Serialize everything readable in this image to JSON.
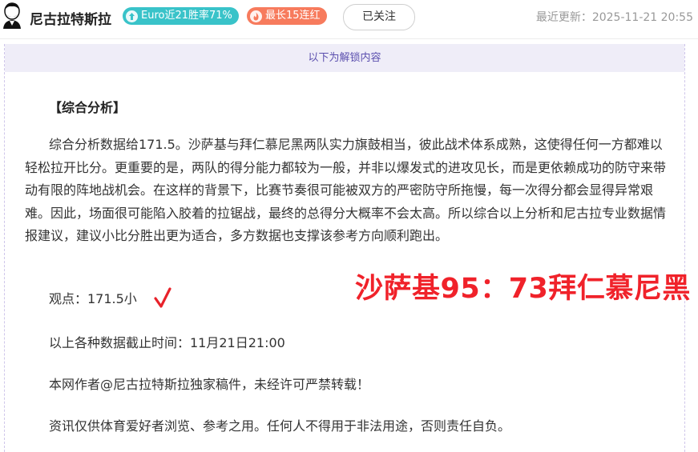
{
  "header": {
    "author_name": "尼古拉特斯拉",
    "badges": [
      {
        "label": "Euro近21胜率71%",
        "icon": "arrow-up-icon",
        "color": "#39c3c9"
      },
      {
        "label": "最长15连红",
        "icon": "flame-icon",
        "color": "#f77b5d"
      }
    ],
    "follow_label": "已关注",
    "updated_label": "最近更新：2025-11-21 20:55"
  },
  "content": {
    "unlock_notice": "以下为解锁内容",
    "section_title": "【综合分析】",
    "paragraph": "综合分析数据给171.5。沙萨基与拜仁慕尼黑两队实力旗鼓相当，彼此战术体系成熟，这使得任何一方都难以轻松拉开比分。更重要的是，两队的得分能力都较为一般，并非以爆发式的进攻见长，而是更依赖成功的防守来带动有限的阵地战机会。在这样的背景下，比赛节奏很可能被双方的严密防守所拖慢，每一次得分都会显得异常艰难。因此，场面很可能陷入胶着的拉锯战，最终的总得分大概率不会太高。所以综合以上分析和尼古拉专业数据情报建议，建议小比分胜出更为适合，多方数据也支撑该参考方向顺利跑出。",
    "viewpoint": "观点：171.5小",
    "deadline": "以上各种数据截止时间：11月21日21:00",
    "copyright": "本网作者@尼古拉特斯拉独家稿件，未经许可严禁转载！",
    "disclaimer": "资讯仅供体育爱好者浏览、参考之用。任何人不得用于非法用途，否则责任自负。",
    "result_overlay": "沙萨基95：73拜仁慕尼黑"
  }
}
